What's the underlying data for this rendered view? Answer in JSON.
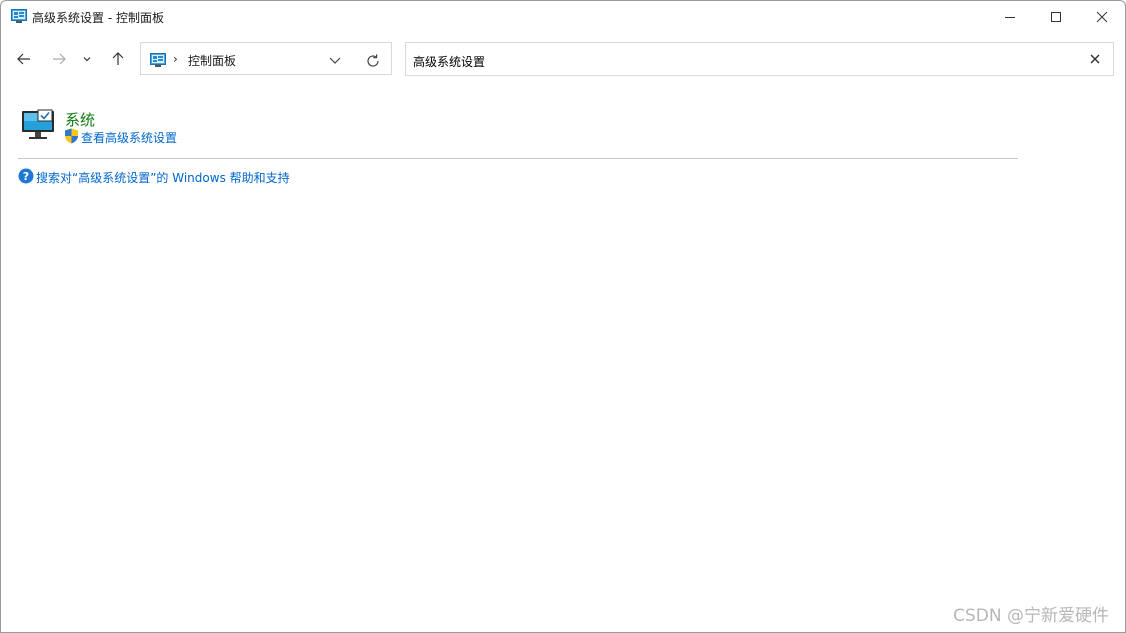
{
  "window": {
    "title": "高级系统设置 - 控制面板"
  },
  "nav": {
    "back_icon": "arrow-left-icon",
    "forward_icon": "arrow-right-icon",
    "recent_icon": "chevron-down-icon",
    "up_icon": "arrow-up-icon"
  },
  "address": {
    "breadcrumb": "控制面板",
    "chevron": "›"
  },
  "search": {
    "value": "高级系统设置"
  },
  "results": {
    "category_title": "系统",
    "link_label": "查看高级系统设置"
  },
  "help": {
    "link_label": "搜索对“高级系统设置”的 Windows 帮助和支持"
  },
  "watermark": "CSDN @宁新爱硬件",
  "colors": {
    "category_green": "#107c10",
    "link_blue": "#0066cc",
    "help_icon_blue": "#1e78d6"
  }
}
